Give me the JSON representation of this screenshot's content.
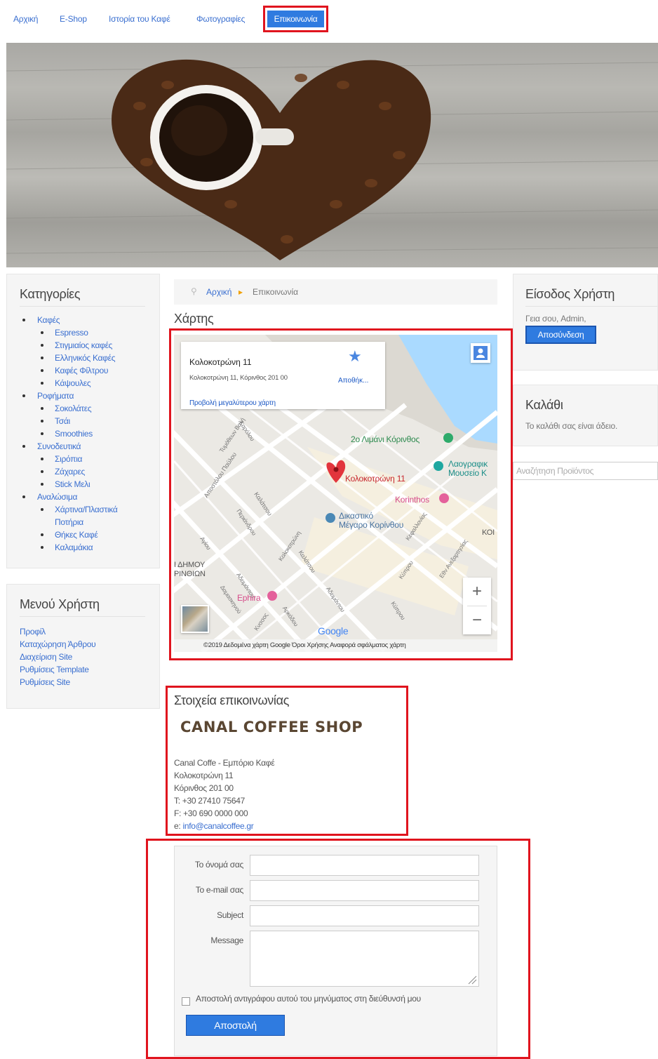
{
  "nav": {
    "items": [
      "Αρχική",
      "E-Shop",
      "Ιστορία του Καφέ",
      "Φωτογραφίες",
      "Επικοινωνία"
    ],
    "active": "Επικοινωνία"
  },
  "categories": {
    "title": "Κατηγορίες",
    "groups": [
      {
        "label": "Καφές",
        "children": [
          "Espresso",
          "Στιγμιαίος καφές",
          "Ελληνικός Καφές",
          "Καφές Φίλτρου",
          "Κάψουλες"
        ]
      },
      {
        "label": "Ροφήματα",
        "children": [
          "Σοκολάτες",
          "Τσάι",
          "Smoothies"
        ]
      },
      {
        "label": "Συνοδευτικά",
        "children": [
          "Σιρόπια",
          "Ζάχαρες",
          "Stick Μελι"
        ]
      },
      {
        "label": "Αναλώσιμα",
        "children": [
          "Χάρτινα/Πλαστικά Ποτήρια",
          "Θήκες Καφέ",
          "Καλαμάκια"
        ]
      }
    ]
  },
  "user_menu": {
    "title": "Μενού Χρήστη",
    "links": [
      "Προφίλ",
      "Καταχώρηση Άρθρου",
      "Διαχείριση Site",
      "Ρυθμίσεις Template",
      "Ρυθμίσεις Site"
    ]
  },
  "login": {
    "title": "Είσοδος Χρήστη",
    "greeting": "Γεια σου, Admin,",
    "logout_label": "Αποσύνδεση"
  },
  "cart": {
    "title": "Καλάθι",
    "empty_text": "Το καλάθι σας είναι άδειο."
  },
  "product_search": {
    "placeholder": "Αναζήτηση Προϊόντος"
  },
  "breadcrumb": {
    "home": "Αρχική",
    "current": "Επικοινωνία"
  },
  "map_section": {
    "title": "Χάρτης",
    "card_title": "Κολοκοτρώνη 11",
    "card_address": "Κολοκοτρώνη 11, Κόρινθος 201 00",
    "card_link": "Προβολή μεγαλύτερου χάρτη",
    "save_label": "Αποθήκ...",
    "labels": {
      "port": "2ο Λιμάνι Κόρινθος",
      "pin": "Κολοκοτρώνη 11",
      "korinthos": "Korinthos",
      "museum_1": "Λαογραφικ",
      "museum_2": "Μουσείο Κ",
      "court_1": "Δικαστικό",
      "court_2": "Μέγαρο Κορίνθου",
      "ephira": "Ephira",
      "dimou_1": "Ι ΔΗΜΟΥ",
      "dimou_2": "ΡΙΝΘΙΩΝ",
      "kor": "ΚΟΙ",
      "streets": [
        "Τυμόθεων Βαλή",
        "Καρόλου",
        "Αποστόλου Παύλου",
        "Καλάτσου",
        "Περιάνδρου",
        "Αγίου",
        "Κολοκοτρώνη",
        "Αδειμάντου",
        "Καλάτσου",
        "Δαμασκηνού",
        "Κύπρου",
        "Αρκάδου",
        "Αδειμάντου",
        "Κνσσος",
        "Εθν Ανεξαρτησίας",
        "Κεφαλλονίας",
        "Κύπρου"
      ]
    },
    "google": "Google",
    "footer": "©2019 Δεδομένα χάρτη Google   Όροι Χρήσης   Αναφορά σφάλματος χάρτη"
  },
  "contact": {
    "title": "Στοιχεία επικοινωνίας",
    "logo_text": "CANAL COFFEE SHOP",
    "lines": [
      "Canal Coffe - Εμπόριο Καφέ",
      "Κολοκοτρώνη 11",
      "Κόρινθος 201 00",
      "T: +30 27410 75647",
      "F: +30 690 0000 000"
    ],
    "email_prefix": "e:",
    "email": "info@canalcoffee.gr"
  },
  "form": {
    "name_label": "Το όνομά σας",
    "email_label": "Το e-mail σας",
    "subject_label": "Subject",
    "message_label": "Message",
    "copy_label": "Αποστολή αντιγράφου αυτού του μηνύματος στη διεύθυνσή μου",
    "send_label": "Αποστολή"
  },
  "colors": {
    "accent": "#2f7be0",
    "link": "#3a6fd0",
    "highlight": "#e0141e"
  }
}
